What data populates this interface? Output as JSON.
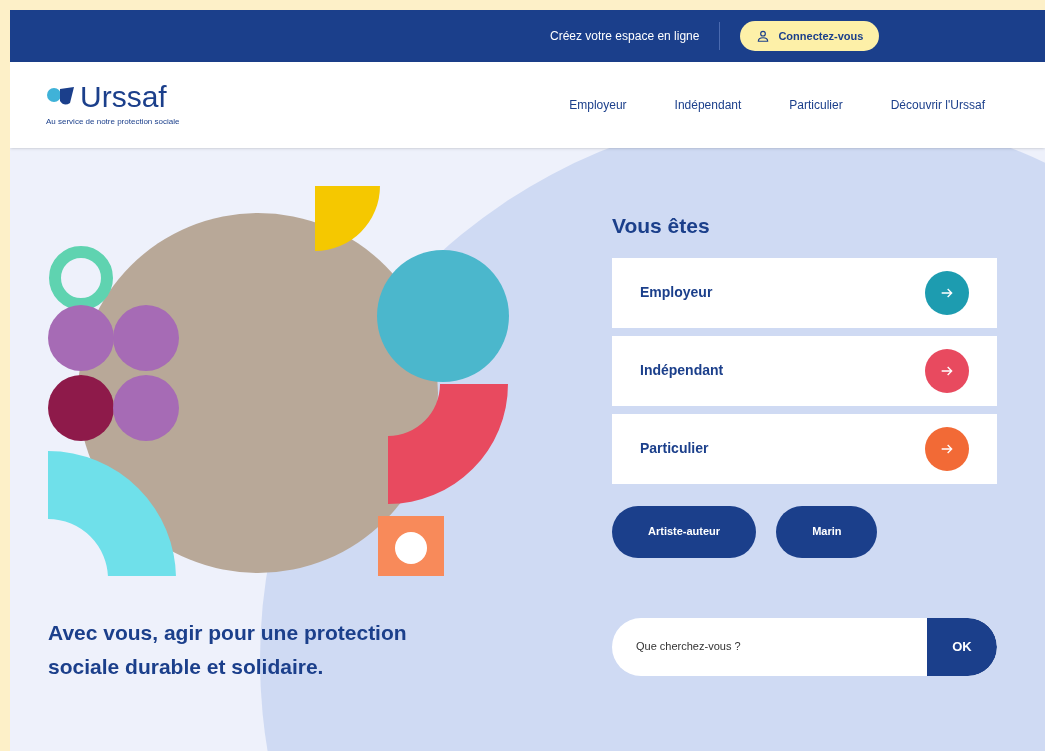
{
  "top_bar": {
    "text": "Créez votre espace en ligne",
    "login_button": "Connectez-vous"
  },
  "header": {
    "logo": "Urssaf",
    "tagline": "Au service de notre protection sociale",
    "nav": [
      "Employeur",
      "Indépendant",
      "Particulier",
      "Découvrir l'Urssaf"
    ]
  },
  "hero": {
    "headline": "Avec vous, agir pour une protection sociale durable et solidaire."
  },
  "profiles": {
    "title": "Vous êtes",
    "cards": [
      {
        "label": "Employeur",
        "color": "#1d9cb0"
      },
      {
        "label": "Indépendant",
        "color": "#e84a5f"
      },
      {
        "label": "Particulier",
        "color": "#f26a36"
      }
    ],
    "pills": [
      "Artiste-auteur",
      "Marin"
    ]
  },
  "search": {
    "placeholder": "Que cherchez-vous ?",
    "button": "OK"
  }
}
